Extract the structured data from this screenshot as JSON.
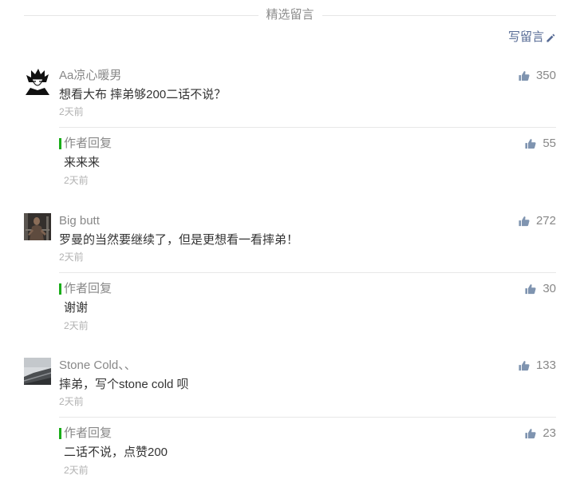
{
  "header": {
    "title": "精选留言",
    "write_label": "写留言"
  },
  "icons": {
    "write": "pencil-icon",
    "like": "thumbs-up-icon"
  },
  "colors": {
    "link": "#576b95",
    "reply_bar": "#1aad19",
    "like_icon": "#7f94b0",
    "text": "#333333",
    "meta": "#888888",
    "time": "#b2b2b2"
  },
  "comments": [
    {
      "nickname": "Aa凉心暖男",
      "content": "想看大布 摔弟够200二话不说？",
      "time": "2天前",
      "likes": 350,
      "reply": {
        "label": "作者回复",
        "content": "来来来",
        "time": "2天前",
        "likes": 55
      }
    },
    {
      "nickname": "Big butt",
      "content": "罗曼的当然要继续了，但是更想看一看摔弟！",
      "time": "2天前",
      "likes": 272,
      "reply": {
        "label": "作者回复",
        "content": "谢谢",
        "time": "2天前",
        "likes": 30
      }
    },
    {
      "nickname": "Stone Cold、、",
      "content": "摔弟，写个stone cold 呗",
      "time": "2天前",
      "likes": 133,
      "reply": {
        "label": "作者回复",
        "content": "二话不说，点赞200",
        "time": "2天前",
        "likes": 23
      }
    }
  ]
}
